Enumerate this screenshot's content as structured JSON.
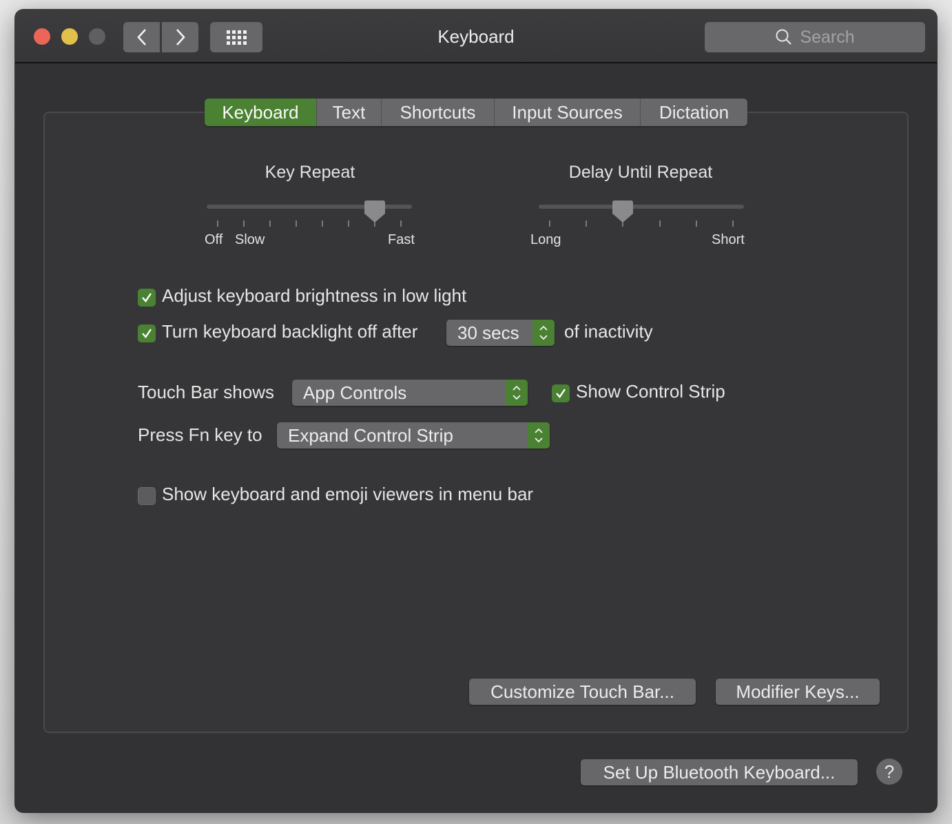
{
  "window": {
    "title": "Keyboard",
    "search_placeholder": "Search",
    "icons": {
      "close": "close-dot",
      "minimize": "minimize-dot",
      "zoom": "zoom-dot-disabled",
      "back": "chevron-left-icon",
      "forward": "chevron-right-icon",
      "show_all": "grid-icon",
      "search": "search-icon"
    }
  },
  "tabs": [
    {
      "label": "Keyboard",
      "active": true
    },
    {
      "label": "Text",
      "active": false
    },
    {
      "label": "Shortcuts",
      "active": false
    },
    {
      "label": "Input Sources",
      "active": false
    },
    {
      "label": "Dictation",
      "active": false
    }
  ],
  "key_repeat": {
    "title": "Key Repeat",
    "labels": {
      "off": "Off",
      "slow": "Slow",
      "fast": "Fast"
    },
    "tick_count": 8,
    "selected_tick_index": 6
  },
  "delay_until_repeat": {
    "title": "Delay Until Repeat",
    "labels": {
      "long": "Long",
      "short": "Short"
    },
    "tick_count": 6,
    "selected_tick_index": 2
  },
  "options": {
    "adjust_brightness": {
      "label": "Adjust keyboard brightness in low light",
      "checked": true
    },
    "backlight_off": {
      "label": "Turn keyboard backlight off after",
      "checked": true,
      "value": "30 secs",
      "suffix": "of inactivity"
    },
    "touch_bar_shows": {
      "label": "Touch Bar shows",
      "value": "App Controls"
    },
    "show_control_strip": {
      "label": "Show Control Strip",
      "checked": true
    },
    "press_fn": {
      "label": "Press Fn key to",
      "value": "Expand Control Strip"
    },
    "show_viewers": {
      "label": "Show keyboard and emoji viewers in menu bar",
      "checked": false
    }
  },
  "buttons": {
    "customize_touch_bar": "Customize Touch Bar...",
    "modifier_keys": "Modifier Keys...",
    "bluetooth": "Set Up Bluetooth Keyboard...",
    "help": "?"
  },
  "colors": {
    "accent": "#4a8132",
    "close": "#ec6559",
    "minimize": "#e2c04c"
  }
}
